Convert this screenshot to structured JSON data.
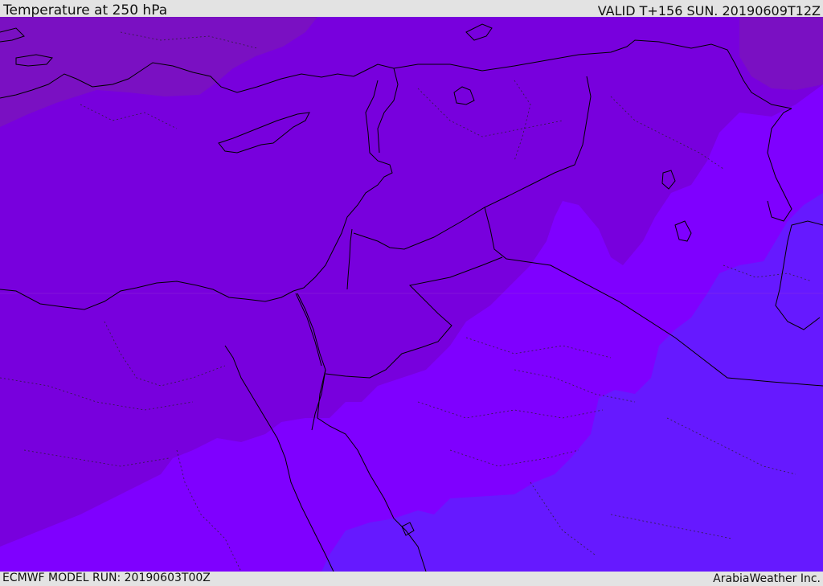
{
  "header": {
    "title": "Temperature at 250 hPa",
    "valid": "VALID T+156 SUN. 20190609T12Z"
  },
  "footer": {
    "model_run": "ECMWF MODEL RUN: 20190603T00Z",
    "credit": "ArabiaWeather Inc."
  },
  "colors": {
    "band_coldest": "#6619ff",
    "band_cold": "#7f00ff",
    "band_mid": "#7800dd",
    "band_warm": "#7a10c2",
    "coastline": "#000000"
  }
}
